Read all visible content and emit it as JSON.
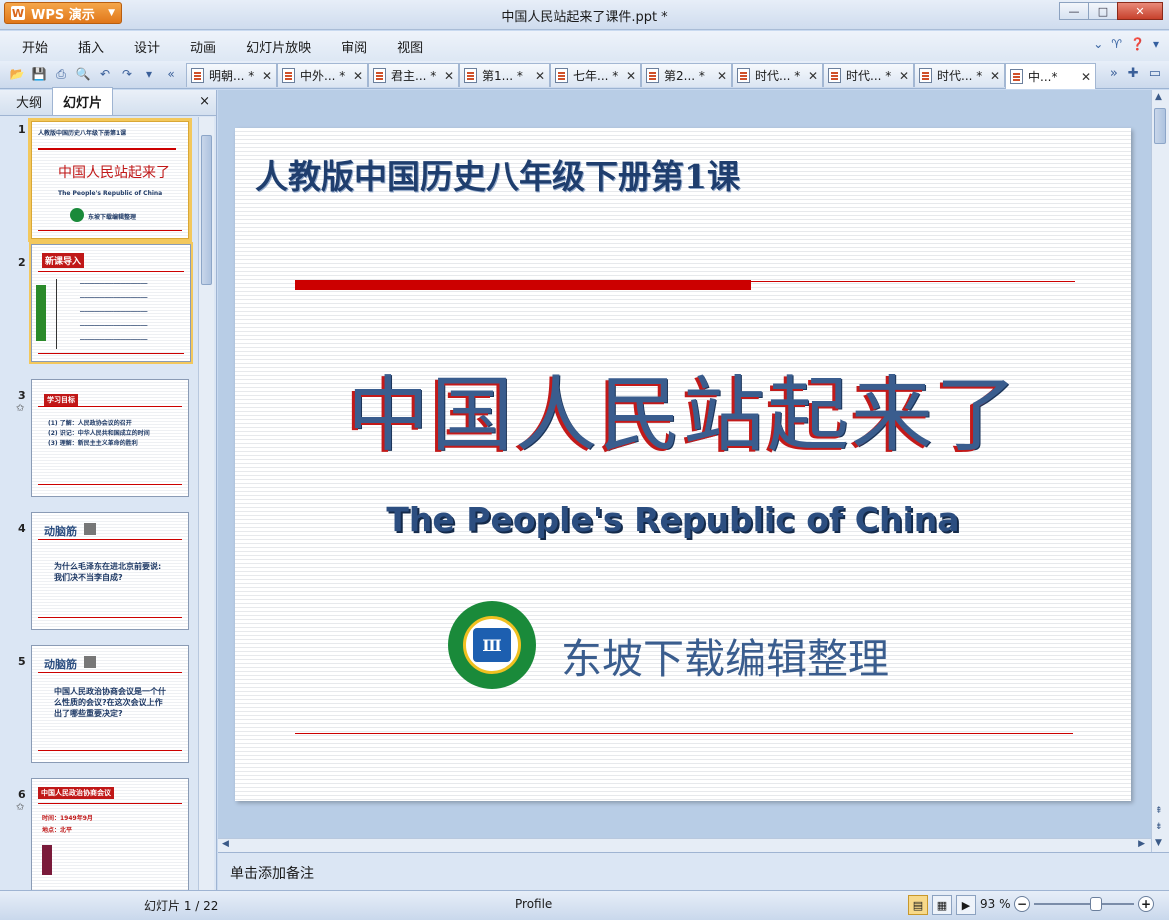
{
  "app": {
    "brand": "WPS 演示",
    "window_title": "中国人民站起来了课件.ppt *"
  },
  "window_controls": {
    "minimize": "—",
    "maximize": "□",
    "close": "✕"
  },
  "menu": [
    "开始",
    "插入",
    "设计",
    "动画",
    "幻灯片放映",
    "审阅",
    "视图"
  ],
  "tabs": [
    {
      "label": "明朝... *"
    },
    {
      "label": "中外... *"
    },
    {
      "label": "君主... *"
    },
    {
      "label": "第1... *"
    },
    {
      "label": "七年... *"
    },
    {
      "label": "第2... *"
    },
    {
      "label": "时代... *"
    },
    {
      "label": "时代... *"
    },
    {
      "label": "时代... *"
    },
    {
      "label": "中...*"
    }
  ],
  "left_panel": {
    "tab_outline": "大纲",
    "tab_slides": "幻灯片",
    "close": "×"
  },
  "thumbnails": [
    {
      "num": "1",
      "top_title": "人教版中国历史八年级下册第1课",
      "title": "中国人民站起来了",
      "subtitle": "The People's Republic of China",
      "author": "东坡下载编辑整理"
    },
    {
      "num": "2",
      "badge": "新课导入"
    },
    {
      "num": "3",
      "badge": "学习目标",
      "lines": [
        "(1) 了解：人民政协会议的召开",
        "(2) 识记：中华人民共和国成立的时间",
        "(3) 理解：新民主主义革命的胜利"
      ]
    },
    {
      "num": "4",
      "heading": "动脑筋",
      "question": "为什么毛泽东在进北京前要说:我们决不当李自成?"
    },
    {
      "num": "5",
      "heading": "动脑筋",
      "question": "中国人民政治协商会议是一个什么性质的会议?在这次会议上作出了哪些重要决定?"
    },
    {
      "num": "6",
      "badge": "中国人民政治协商会议",
      "lines": [
        "时间：1949年9月",
        "地点：北平"
      ]
    }
  ],
  "slide": {
    "top_title": "人教版中国历史八年级下册第1课",
    "main_title": "中国人民站起来了",
    "subtitle": "The People's Republic of China",
    "author": "东坡下载编辑整理",
    "logo_char": "Ⅲ"
  },
  "notes_placeholder": "单击添加备注",
  "status": {
    "page": "幻灯片 1 / 22",
    "theme": "Profile",
    "zoom": "93 %"
  },
  "colors": {
    "accent_red": "#cc0000",
    "title_blue": "#3a5d8e",
    "brand_orange": "#e0771a"
  }
}
